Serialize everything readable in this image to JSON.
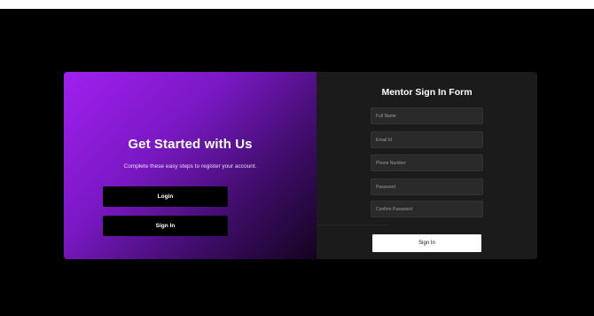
{
  "colors": {
    "page_background": "#000000",
    "gradient_start": "#a020ef",
    "gradient_end": "#140320",
    "form_panel": "#1b1b1b",
    "input_background": "#2a2a2a",
    "submit_button": "#ffffff"
  },
  "intro": {
    "title": "Get Started with Us",
    "subtitle": "Complete these easy steps to register your account.",
    "login_label": "Login",
    "signin_label": "Sign In"
  },
  "form": {
    "title": "Mentor Sign In Form",
    "fields": [
      {
        "placeholder": "Full Name"
      },
      {
        "placeholder": "Email Id"
      },
      {
        "placeholder": "Phone Number"
      },
      {
        "placeholder": "Password"
      },
      {
        "placeholder": "Confirm Password"
      }
    ],
    "submit_label": "Sign In"
  }
}
